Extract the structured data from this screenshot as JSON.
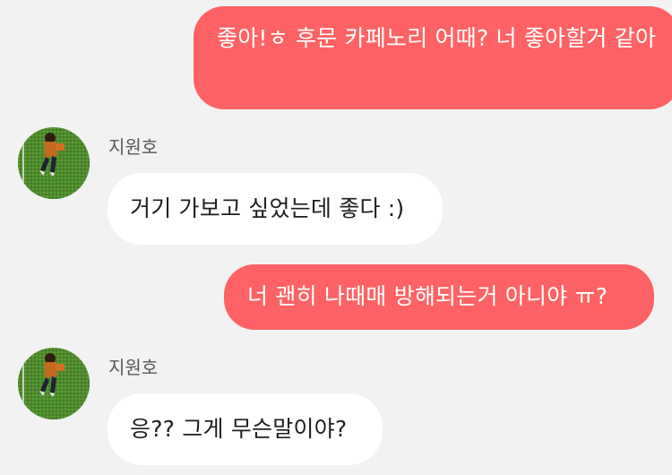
{
  "messages": [
    {
      "direction": "outgoing",
      "text": "좋아!ㅎ 후문 카페노리 어때? 너 좋아할거 같아"
    },
    {
      "direction": "incoming",
      "sender": "지원호",
      "avatar_icon": "profile-photo-person-on-grass",
      "text": "거기 가보고 싶었는데 좋다 :)"
    },
    {
      "direction": "outgoing",
      "text": "너 괜히 나때매 방해되는거 아니야 ㅠ?"
    },
    {
      "direction": "incoming",
      "sender": "지원호",
      "avatar_icon": "profile-photo-person-on-grass",
      "text": "응?? 그게 무슨말이야?"
    }
  ],
  "colors": {
    "background": "#f2f2f2",
    "outgoing_bubble": "#fe6264",
    "incoming_bubble": "#ffffff"
  }
}
